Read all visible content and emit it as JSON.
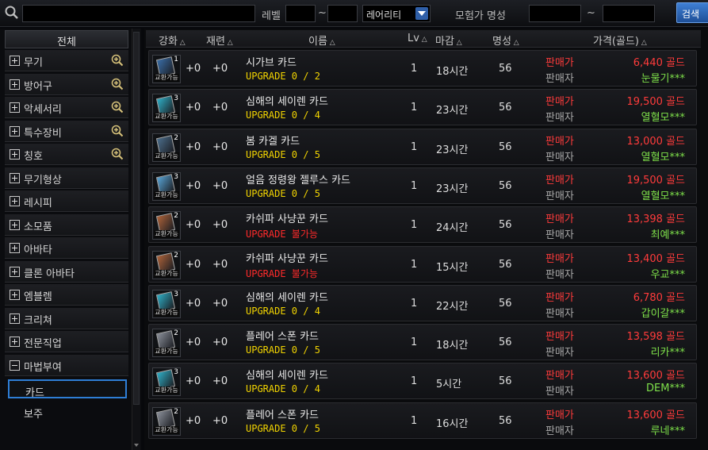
{
  "search": {
    "value": "",
    "level_label": "레벨",
    "level_sep": "~",
    "rarity": "레어리티",
    "adv_label": "모험가 명성",
    "adv_sep": "~",
    "button": "검색"
  },
  "sidebar": {
    "all": "전체",
    "categories": [
      {
        "label": "무기",
        "zoom": true,
        "expanded": false
      },
      {
        "label": "방어구",
        "zoom": true,
        "expanded": false
      },
      {
        "label": "악세서리",
        "zoom": true,
        "expanded": false
      },
      {
        "label": "특수장비",
        "zoom": true,
        "expanded": false
      },
      {
        "label": "칭호",
        "zoom": true,
        "expanded": false
      },
      {
        "label": "무기형상",
        "zoom": false,
        "expanded": false
      },
      {
        "label": "레시피",
        "zoom": false,
        "expanded": false
      },
      {
        "label": "소모품",
        "zoom": false,
        "expanded": false
      },
      {
        "label": "아바타",
        "zoom": false,
        "expanded": false
      },
      {
        "label": "클론 아바타",
        "zoom": false,
        "expanded": false
      },
      {
        "label": "엠블렘",
        "zoom": false,
        "expanded": false
      },
      {
        "label": "크리쳐",
        "zoom": false,
        "expanded": false
      },
      {
        "label": "전문직업",
        "zoom": false,
        "expanded": false
      },
      {
        "label": "마법부여",
        "zoom": false,
        "expanded": true
      }
    ],
    "subitems": [
      {
        "label": "카드",
        "selected": true
      },
      {
        "label": "보주",
        "selected": false
      }
    ]
  },
  "columns": [
    "강화",
    "재련",
    "이름",
    "Lv",
    "마감",
    "명성",
    "가격(골드)"
  ],
  "rows": [
    {
      "enh": "+0",
      "ref": "+0",
      "name": "시가브 카드",
      "upgrade": "UPGRADE 0 / 2",
      "upg_ok": true,
      "lv": "1",
      "deadline": "18시간",
      "fame": "56",
      "sell_label": "판매가",
      "price": "6,440 골드",
      "seller_label": "판매자",
      "seller": "눈물기***",
      "card_color": "#3a6ea8",
      "num": "1"
    },
    {
      "enh": "+0",
      "ref": "+0",
      "name": "심해의 세이렌 카드",
      "upgrade": "UPGRADE 0 / 4",
      "upg_ok": true,
      "lv": "1",
      "deadline": "23시간",
      "fame": "56",
      "sell_label": "판매가",
      "price": "19,500 골드",
      "seller_label": "판매자",
      "seller": "열혈모***",
      "card_color": "#2fb0c8",
      "num": "3"
    },
    {
      "enh": "+0",
      "ref": "+0",
      "name": "봄 카겔 카드",
      "upgrade": "UPGRADE 0 / 5",
      "upg_ok": true,
      "lv": "1",
      "deadline": "23시간",
      "fame": "56",
      "sell_label": "판매가",
      "price": "13,000 골드",
      "seller_label": "판매자",
      "seller": "열혈모***",
      "card_color": "#4c6e8c",
      "num": "2"
    },
    {
      "enh": "+0",
      "ref": "+0",
      "name": "얼음 정령왕 젤루스 카드",
      "upgrade": "UPGRADE 0 / 5",
      "upg_ok": true,
      "lv": "1",
      "deadline": "23시간",
      "fame": "56",
      "sell_label": "판매가",
      "price": "19,500 골드",
      "seller_label": "판매자",
      "seller": "열혈모***",
      "card_color": "#5aa6d8",
      "num": "3"
    },
    {
      "enh": "+0",
      "ref": "+0",
      "name": "카쉬파 사냥꾼 카드",
      "upgrade": "UPGRADE 불가능",
      "upg_ok": false,
      "lv": "1",
      "deadline": "24시간",
      "fame": "56",
      "sell_label": "판매가",
      "price": "13,398 골드",
      "seller_label": "판매자",
      "seller": "최예***",
      "card_color": "#b0643a",
      "num": "2"
    },
    {
      "enh": "+0",
      "ref": "+0",
      "name": "카쉬파 사냥꾼 카드",
      "upgrade": "UPGRADE 불가능",
      "upg_ok": false,
      "lv": "1",
      "deadline": "15시간",
      "fame": "56",
      "sell_label": "판매가",
      "price": "13,400 골드",
      "seller_label": "판매자",
      "seller": "우교***",
      "card_color": "#b0643a",
      "num": "2"
    },
    {
      "enh": "+0",
      "ref": "+0",
      "name": "심해의 세이렌 카드",
      "upgrade": "UPGRADE 0 / 4",
      "upg_ok": true,
      "lv": "1",
      "deadline": "22시간",
      "fame": "56",
      "sell_label": "판매가",
      "price": "6,780 골드",
      "seller_label": "판매자",
      "seller": "갑이갈***",
      "card_color": "#2fb0c8",
      "num": "3"
    },
    {
      "enh": "+0",
      "ref": "+0",
      "name": "플레어 스폰 카드",
      "upgrade": "UPGRADE 0 / 5",
      "upg_ok": true,
      "lv": "1",
      "deadline": "18시간",
      "fame": "56",
      "sell_label": "판매가",
      "price": "13,598 골드",
      "seller_label": "판매자",
      "seller": "리카***",
      "card_color": "#8a8f99",
      "num": "2"
    },
    {
      "enh": "+0",
      "ref": "+0",
      "name": "심해의 세이렌 카드",
      "upgrade": "UPGRADE 0 / 4",
      "upg_ok": true,
      "lv": "1",
      "deadline": "5시간",
      "fame": "56",
      "sell_label": "판매가",
      "price": "13,600 골드",
      "seller_label": "판매자",
      "seller": "DEM***",
      "card_color": "#2fb0c8",
      "num": "3"
    },
    {
      "enh": "+0",
      "ref": "+0",
      "name": "플레어 스폰 카드",
      "upgrade": "UPGRADE 0 / 5",
      "upg_ok": true,
      "lv": "1",
      "deadline": "16시간",
      "fame": "56",
      "sell_label": "판매가",
      "price": "13,600 골드",
      "seller_label": "판매자",
      "seller": "루네***",
      "card_color": "#8a8f99",
      "num": "2"
    }
  ],
  "tradeable_tag": "교환가능",
  "colors": {
    "sell": "#ff3b3b",
    "seller": "#7ee04a",
    "upgrade_ok": "#f2d400",
    "upgrade_no": "#ff2a2a",
    "accent": "#2e7ed6"
  }
}
